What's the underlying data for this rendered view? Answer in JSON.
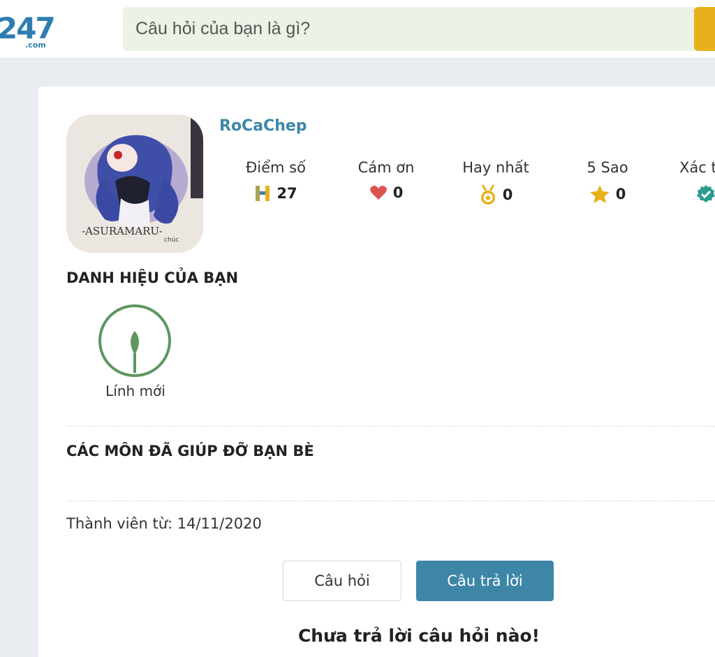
{
  "header": {
    "logo_number": "247",
    "logo_suffix": ".com",
    "search_placeholder": "Câu hỏi của bạn là gì?"
  },
  "profile": {
    "username": "RoCaChep",
    "avatar_caption": "-ASURAMARU-",
    "stats": [
      {
        "label": "Điểm số",
        "value": "27",
        "icon": "h-points-icon",
        "color": "#e8b11c"
      },
      {
        "label": "Cám ơn",
        "value": "0",
        "icon": "heart-icon",
        "color": "#d9534f"
      },
      {
        "label": "Hay nhất",
        "value": "0",
        "icon": "medal-icon",
        "color": "#e8b11c"
      },
      {
        "label": "5 Sao",
        "value": "0",
        "icon": "star-icon",
        "color": "#e8b11c"
      },
      {
        "label": "Xác t",
        "value": "",
        "icon": "check-circle-icon",
        "color": "#2a9d8f"
      }
    ]
  },
  "titles_section": {
    "heading": "DANH HIỆU CỦA BẠN",
    "badge_label": "Lính mới",
    "badge_icon": "leaf-icon",
    "badge_color": "#5e9560"
  },
  "subjects_section": {
    "heading": "CÁC MÔN ĐÃ GIÚP ĐỠ BẠN BÈ"
  },
  "member_since": "Thành viên từ: 14/11/2020",
  "tabs": {
    "questions_label": "Câu hỏi",
    "answers_label": "Câu trả lời",
    "active": "answers"
  },
  "empty_message": "Chưa trả lời câu hỏi nào!",
  "colors": {
    "accent": "#3d86a8",
    "search_bg": "#eaf3e5",
    "search_button": "#e8b11c",
    "page_bg": "#e9edf1"
  }
}
